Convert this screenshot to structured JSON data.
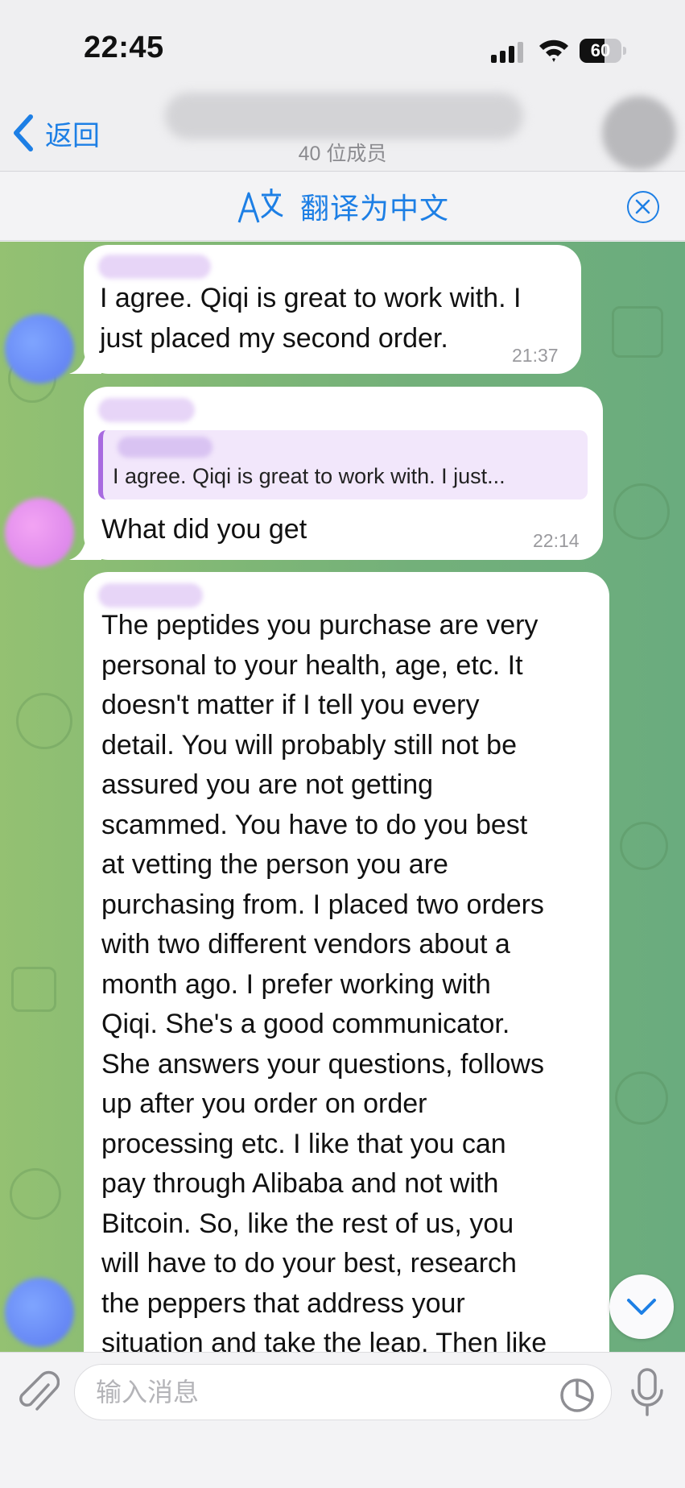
{
  "status_bar": {
    "time": "22:45",
    "battery_level": "60",
    "icons": [
      "signal-icon",
      "wifi-icon",
      "battery-icon"
    ]
  },
  "header": {
    "back_label": "返回",
    "member_count": "40 位成员"
  },
  "translate_bar": {
    "label": "翻译为中文",
    "icons": [
      "translate-icon",
      "close-circle-icon"
    ]
  },
  "messages": [
    {
      "lines": [
        "I agree. Qiqi is great to work with. I",
        "just placed my second order."
      ],
      "time": "21:37"
    },
    {
      "reply_preview": "I agree. Qiqi is great to work with. I just...",
      "lines": [
        "What did you get"
      ],
      "time": "22:14"
    },
    {
      "lines": [
        "The peptides you purchase are very",
        "personal to your health, age, etc. It",
        "doesn't matter if I tell you every",
        "detail. You will probably still not be",
        "assured you are not getting",
        "scammed. You have to do you best",
        "at vetting the person you are",
        "purchasing from. I placed two orders",
        "with two different vendors about a",
        "month ago. I prefer working with",
        "Qiqi. She's a good communicator.",
        "She answers your questions, follows",
        "up after you order on order",
        "processing etc. I like that you can",
        "pay through Alibaba and not with",
        "Bitcoin. So, like the rest of us, you",
        "will have to do your best, research",
        "the peppers that address your",
        "situation and take the leap. Then like"
      ]
    }
  ],
  "input_bar": {
    "placeholder": "输入消息",
    "icons": [
      "paperclip-icon",
      "sticker-icon",
      "microphone-icon"
    ]
  },
  "scroll_down_icon": "chevron-down-icon",
  "colors": {
    "accent": "#1d7fe5",
    "bubble": "#ffffff",
    "reply_bar": "#a86ae0",
    "chat_bg_left": "#94c172",
    "chat_bg_right": "#6aac7e"
  }
}
